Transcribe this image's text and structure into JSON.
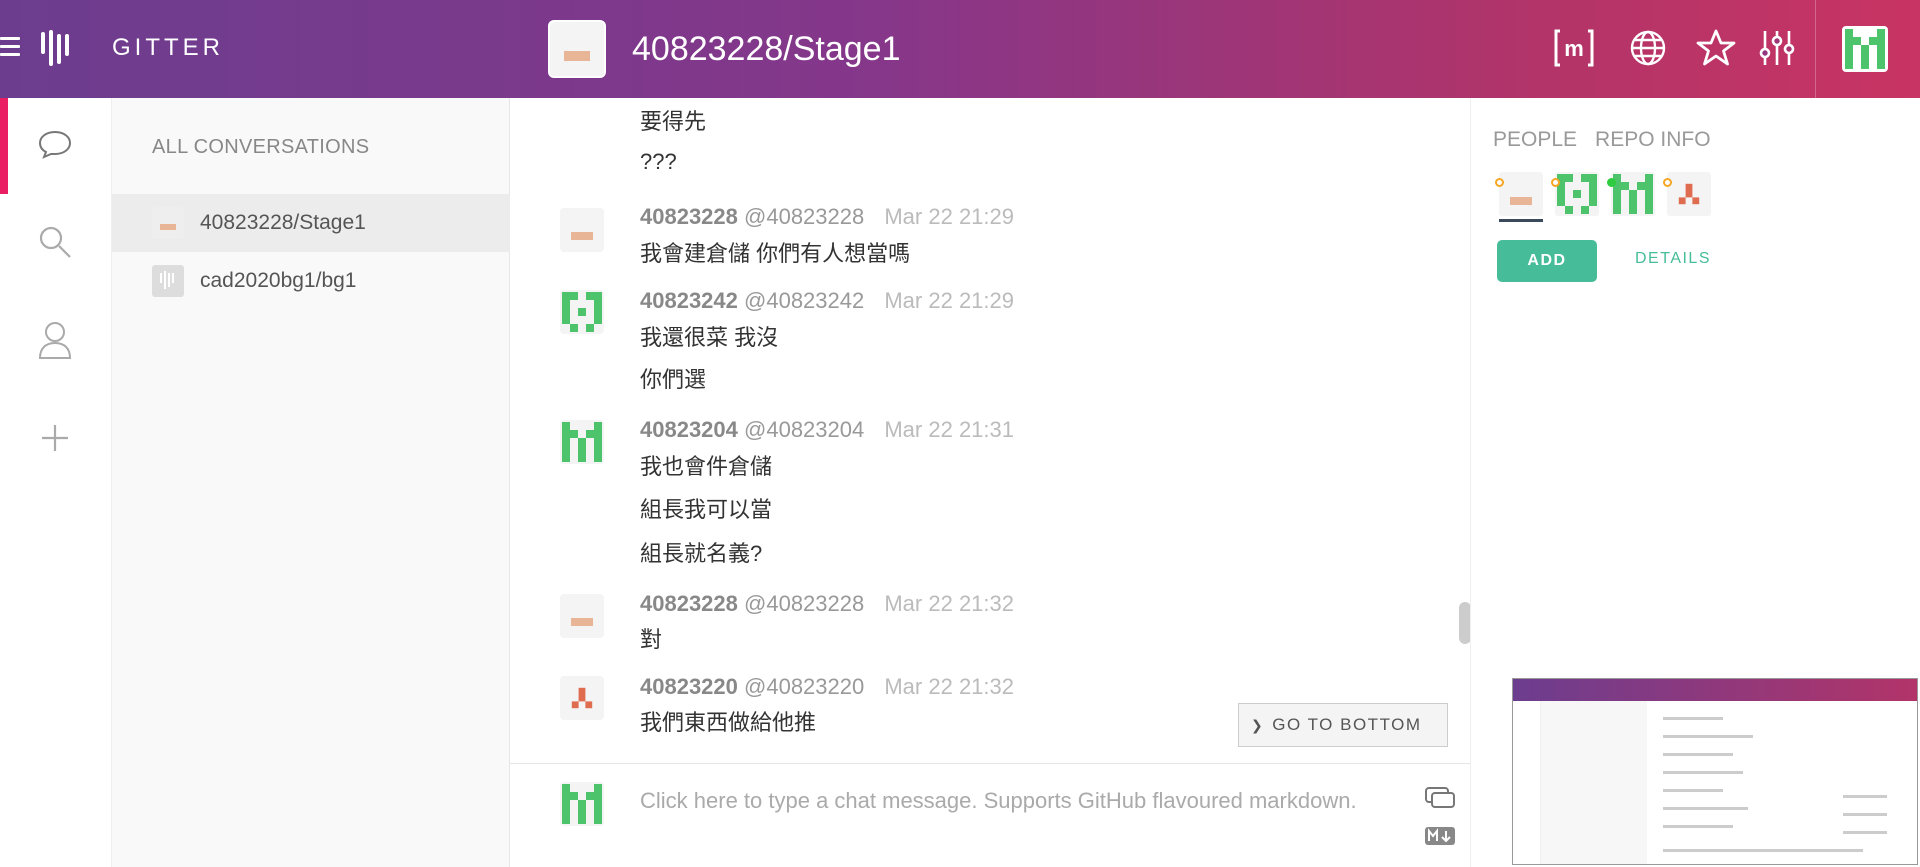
{
  "header": {
    "brand": "GITTER",
    "room_title": "40823228/Stage1",
    "icons": [
      "matrix-icon",
      "globe-icon",
      "star-icon",
      "settings-sliders-icon"
    ]
  },
  "rail": {
    "icons": [
      "chat-bubble-icon",
      "search-icon",
      "user-icon",
      "plus-icon"
    ]
  },
  "conversations": {
    "title": "ALL CONVERSATIONS",
    "items": [
      {
        "name": "40823228/Stage1"
      },
      {
        "name": "cad2020bg1/bg1"
      }
    ]
  },
  "chat": {
    "top_lines": [
      "要得先",
      "???"
    ],
    "messages": [
      {
        "user": "40823228",
        "handle": "@40823228",
        "time": "Mar 22 21:29",
        "lines": [
          "我會建倉儲 你們有人想當嗎"
        ]
      },
      {
        "user": "40823242",
        "handle": "@40823242",
        "time": "Mar 22 21:29",
        "lines": [
          "我還很菜 我沒",
          "你們選"
        ]
      },
      {
        "user": "40823204",
        "handle": "@40823204",
        "time": "Mar 22 21:31",
        "lines": [
          "我也會件倉儲",
          "組長我可以當",
          "組長就名義?"
        ]
      },
      {
        "user": "40823228",
        "handle": "@40823228",
        "time": "Mar 22 21:32",
        "lines": [
          "對"
        ]
      },
      {
        "user": "40823220",
        "handle": "@40823220",
        "time": "Mar 22 21:32",
        "lines": [
          "我們東西做給他推"
        ]
      }
    ],
    "go_to_bottom": "GO TO BOTTOM"
  },
  "composer": {
    "placeholder": "Click here to type a chat message. Supports GitHub flavoured markdown."
  },
  "right_panel": {
    "tabs": [
      "PEOPLE",
      "REPO INFO"
    ],
    "add_label": "ADD",
    "details_label": "DETAILS"
  },
  "colors": {
    "header_start": "#6c3d8f",
    "header_end": "#c83463",
    "accent_pink": "#e91e63",
    "accent_green": "#46bc99"
  }
}
